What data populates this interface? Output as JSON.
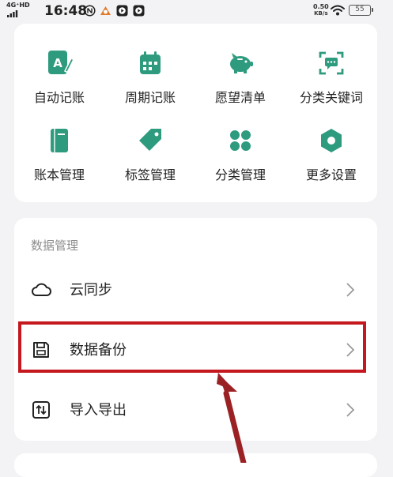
{
  "status_bar": {
    "network": "4G⁺HD",
    "time": "16:48",
    "speed_value": "0.50",
    "speed_unit": "KB/s",
    "battery": "55",
    "icons": [
      "nfc-icon",
      "app-notification-icon",
      "video-app-icon",
      "video-app-icon",
      "wifi-icon",
      "battery-icon"
    ]
  },
  "tools": {
    "items": [
      {
        "label": "自动记账",
        "icon": "auto-bookkeeping-icon"
      },
      {
        "label": "周期记账",
        "icon": "calendar-icon"
      },
      {
        "label": "愿望清单",
        "icon": "piggy-bank-icon"
      },
      {
        "label": "分类关键词",
        "icon": "keyword-scan-icon"
      },
      {
        "label": "账本管理",
        "icon": "ledger-book-icon"
      },
      {
        "label": "标签管理",
        "icon": "tag-icon"
      },
      {
        "label": "分类管理",
        "icon": "category-grid-icon"
      },
      {
        "label": "更多设置",
        "icon": "settings-icon"
      }
    ],
    "accent_color": "#2e9b7e"
  },
  "data_management": {
    "title": "数据管理",
    "items": [
      {
        "label": "云同步",
        "icon": "cloud-icon"
      },
      {
        "label": "数据备份",
        "icon": "save-disk-icon"
      },
      {
        "label": "导入导出",
        "icon": "import-export-icon"
      }
    ]
  },
  "annotation": {
    "highlight_color": "#c4181e",
    "arrow_color": "#9b2224"
  }
}
